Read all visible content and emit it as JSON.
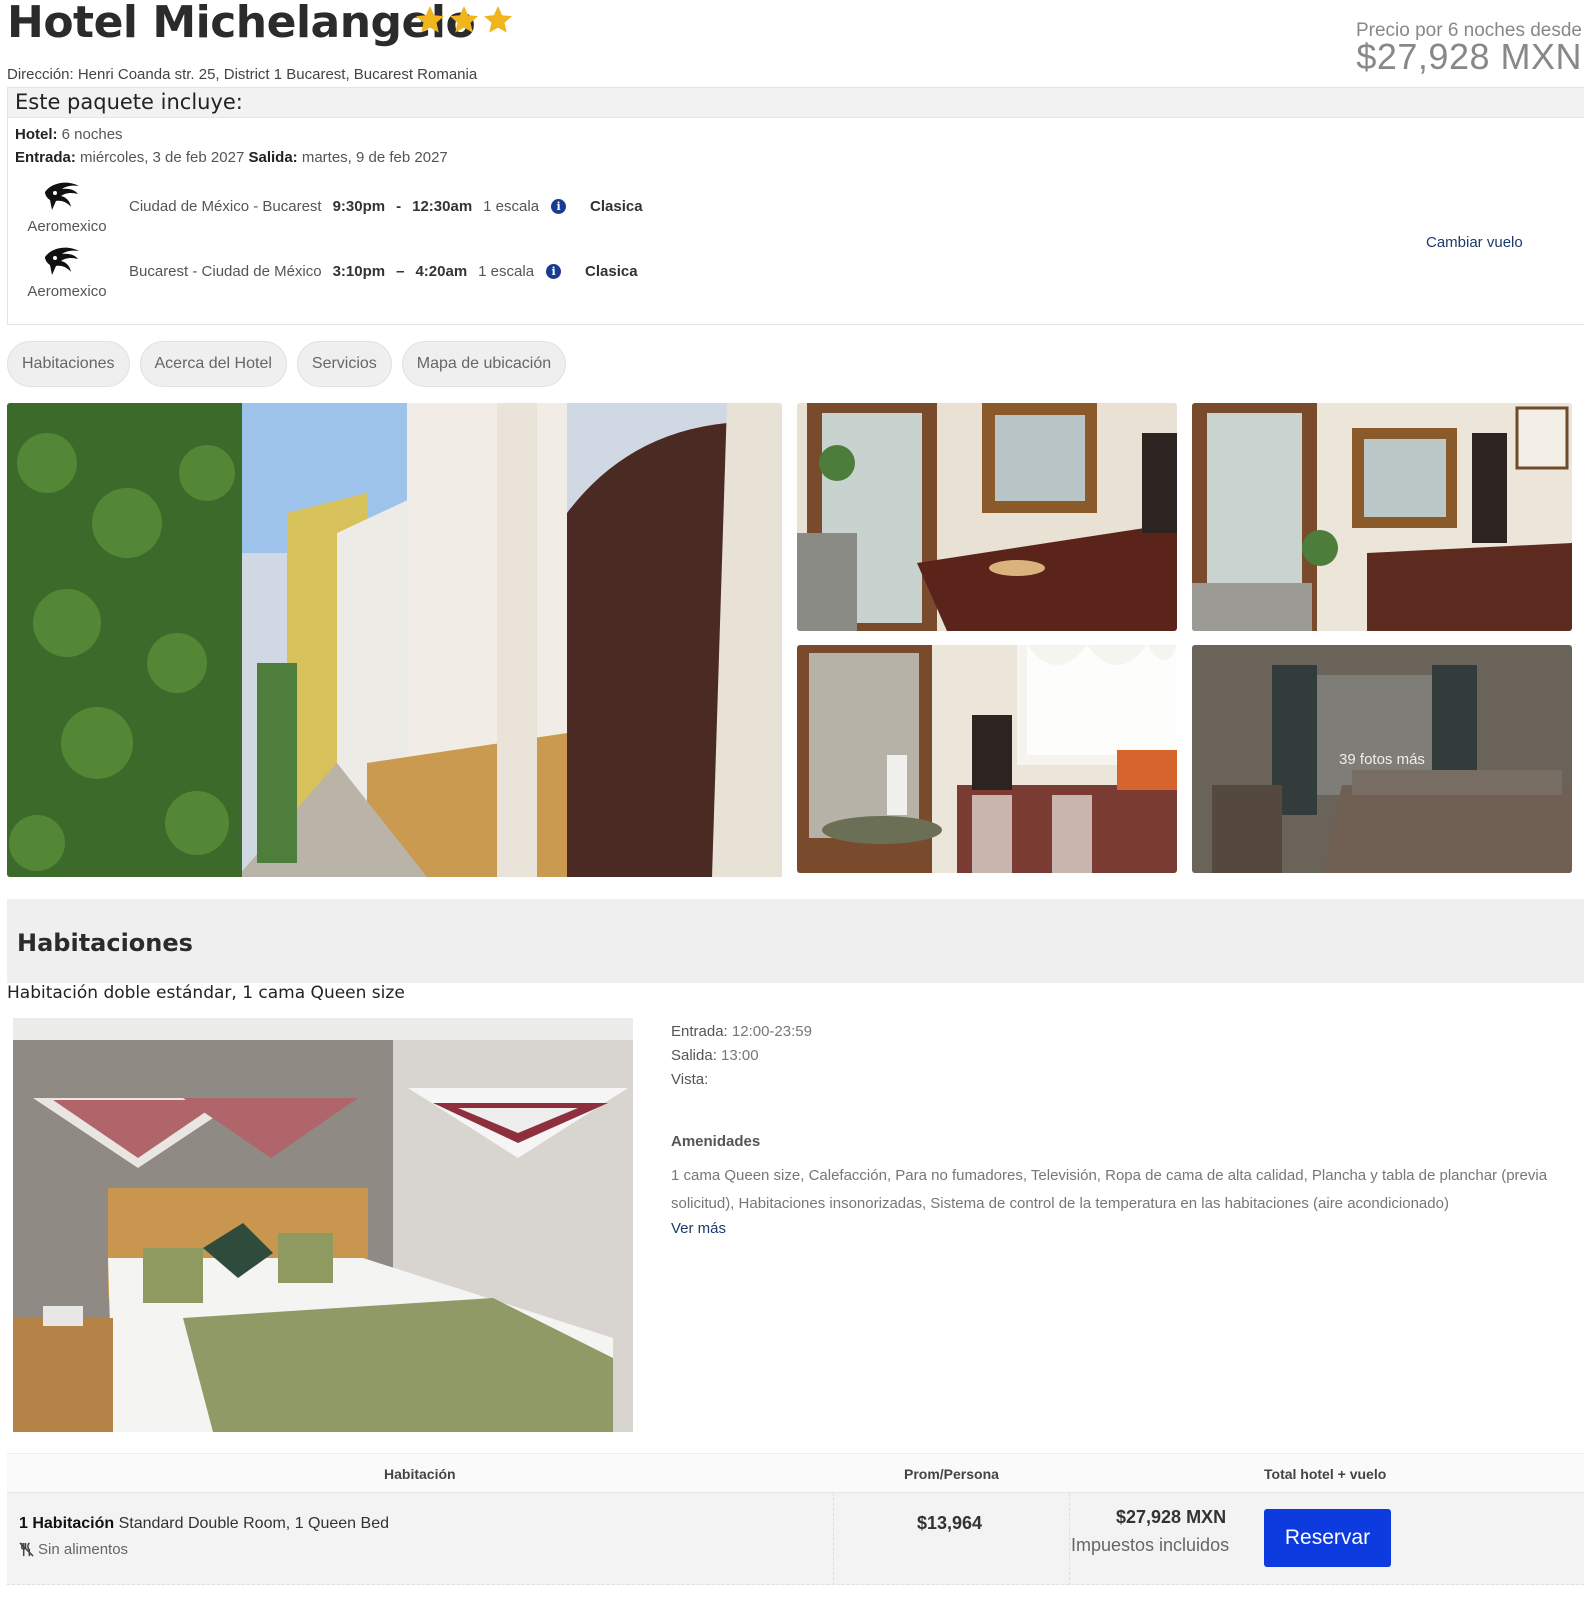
{
  "hotel": {
    "name": "Hotel Michelangelo",
    "stars": 3,
    "address": "Dirección: Henri Coanda str. 25, District 1 Bucarest, Bucarest Romania",
    "price_label": "Precio por 6 noches desde",
    "price": "$27,928 MXN"
  },
  "package": {
    "heading": "Este paquete incluye:",
    "hotel_label": "Hotel:",
    "hotel_nights": "6 noches",
    "checkin_label": "Entrada:",
    "checkin_date": "miércoles, 3 de feb 2027",
    "checkout_label": "Salida:",
    "checkout_date": "martes, 9 de feb 2027",
    "change_flight": "Cambiar vuelo",
    "flights": [
      {
        "airline": "Aeromexico",
        "route": "Ciudad de México - Bucarest",
        "depart": "9:30pm",
        "sep": "-",
        "arrive": "12:30am",
        "stops": "1 escala",
        "fare": "Clasica"
      },
      {
        "airline": "Aeromexico",
        "route": "Bucarest - Ciudad de México",
        "depart": "3:10pm",
        "sep": "–",
        "arrive": "4:20am",
        "stops": "1 escala",
        "fare": "Clasica"
      }
    ]
  },
  "tabs": [
    "Habitaciones",
    "Acerca del Hotel",
    "Servicios",
    "Mapa de ubicación"
  ],
  "gallery": {
    "more_photos": "39 fotos más"
  },
  "rooms": {
    "section_title": "Habitaciones",
    "room_name": "Habitación doble estándar, 1 cama Queen size",
    "checkin_label": "Entrada:",
    "checkin_value": "12:00-23:59",
    "checkout_label": "Salida:",
    "checkout_value": "13:00",
    "view_label": "Vista:",
    "amenities_title": "Amenidades",
    "amenities": "1 cama Queen size, Calefacción, Para no fumadores, Televisión, Ropa de cama de alta calidad, Plancha y tabla de planchar (previa solicitud), Habitaciones insonorizadas, Sistema de control de la temperatura en las habitaciones (aire acondicionado)",
    "see_more": "Ver más"
  },
  "rates": {
    "headers": {
      "room": "Habitación",
      "avg": "Prom/Persona",
      "total": "Total hotel + vuelo"
    },
    "row": {
      "qty": "1 Habitación",
      "room": "Standard Double Room, 1 Queen Bed",
      "meal": "Sin alimentos",
      "avg": "$13,964",
      "total": "$27,928 MXN",
      "tax": "Impuestos incluidos",
      "button": "Reservar"
    }
  },
  "colors": {
    "star": "#f0b41c",
    "button": "#0d3be0",
    "link": "#1b3a6b",
    "info": "#1a3c8f"
  },
  "icons": [
    "star-icon",
    "aeromexico-logo-icon",
    "info-icon",
    "no-meal-icon"
  ]
}
